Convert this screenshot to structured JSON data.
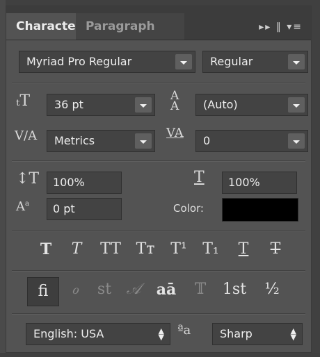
{
  "tabs": {
    "character": "Character",
    "paragraph": "Paragraph",
    "menu_icons": "▸▸ ‖ ▾≡"
  },
  "font": {
    "family": "Myriad Pro Regular",
    "style": "Regular"
  },
  "size": {
    "font_size": "36 pt",
    "leading": "(Auto)",
    "kerning": "Metrics",
    "tracking": "0"
  },
  "scale": {
    "vertical": "100%",
    "horizontal": "100%",
    "baseline_shift": "0 pt",
    "color_label": "Color:",
    "color_value": "#000000"
  },
  "styles": [
    "T",
    "T",
    "TT",
    "Tт",
    "T¹",
    "T₁",
    "T",
    "T"
  ],
  "opentype": [
    "fi",
    "ℴ",
    "st",
    "𝒜",
    "aā",
    "𝕋",
    "1st",
    "½"
  ],
  "footer": {
    "language": "English: USA",
    "aa_icon": "ªa",
    "antialias": "Sharp"
  }
}
